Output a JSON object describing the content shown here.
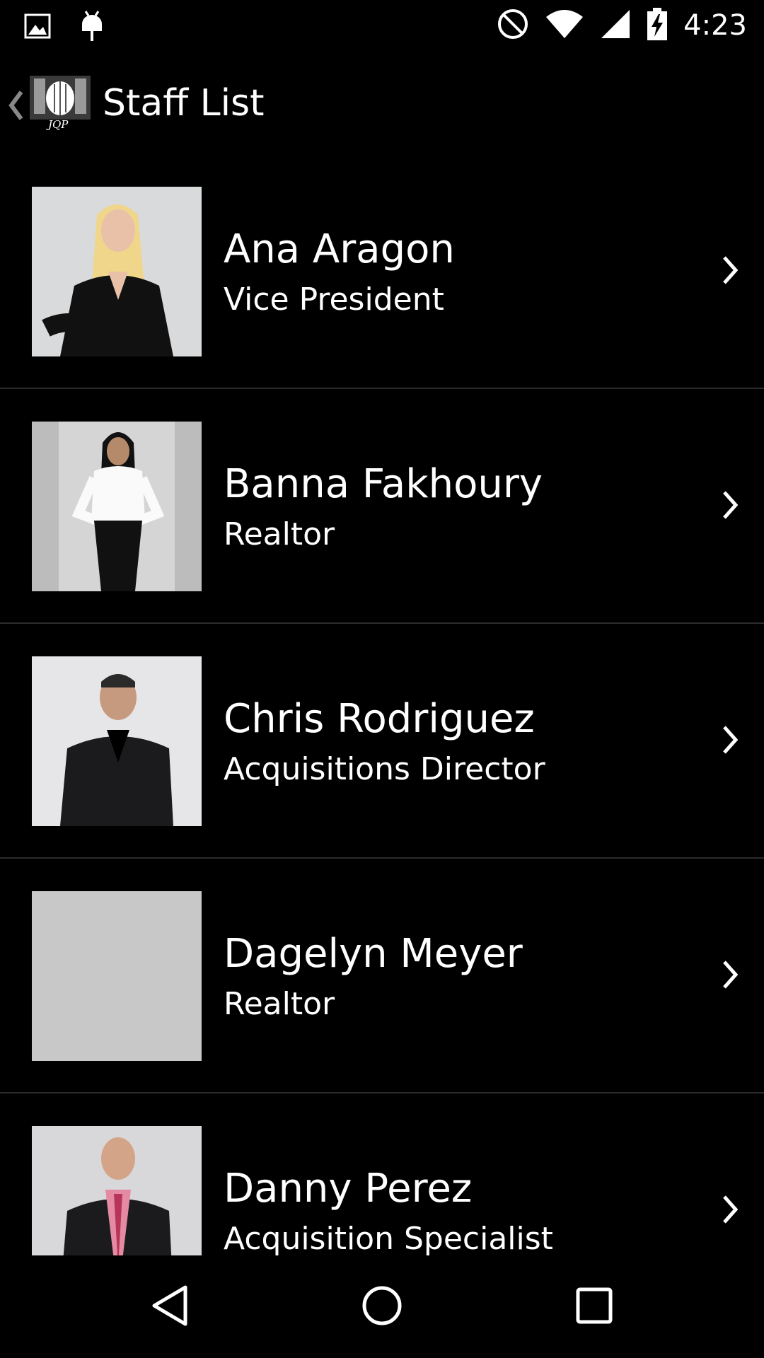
{
  "status_bar": {
    "time": "4:23",
    "left_icons": [
      "image-notification-icon",
      "android-debug-icon"
    ],
    "right_icons": [
      "do-not-disturb-icon",
      "wifi-icon",
      "cell-signal-icon",
      "battery-charging-icon"
    ]
  },
  "action_bar": {
    "title": "Staff List",
    "logo_text": "JQP"
  },
  "staff": [
    {
      "name": "Ana Aragon",
      "role": "Vice President",
      "photo": "photo-ana-aragon"
    },
    {
      "name": "Banna Fakhoury",
      "role": "Realtor",
      "photo": "photo-banna-fakhoury"
    },
    {
      "name": "Chris Rodriguez",
      "role": "Acquisitions Director",
      "photo": "photo-chris-rodriguez"
    },
    {
      "name": "Dagelyn Meyer",
      "role": "Realtor",
      "photo": "photo-placeholder"
    },
    {
      "name": "Danny Perez",
      "role": "Acquisition Specialist",
      "photo": "photo-danny-perez"
    }
  ],
  "nav_bar": {
    "buttons": [
      "back-icon",
      "home-icon",
      "recents-icon"
    ]
  },
  "colors": {
    "background": "#000000",
    "text": "#ffffff",
    "divider": "#2b2b2b",
    "placeholder_photo": "#c8c8c8"
  }
}
